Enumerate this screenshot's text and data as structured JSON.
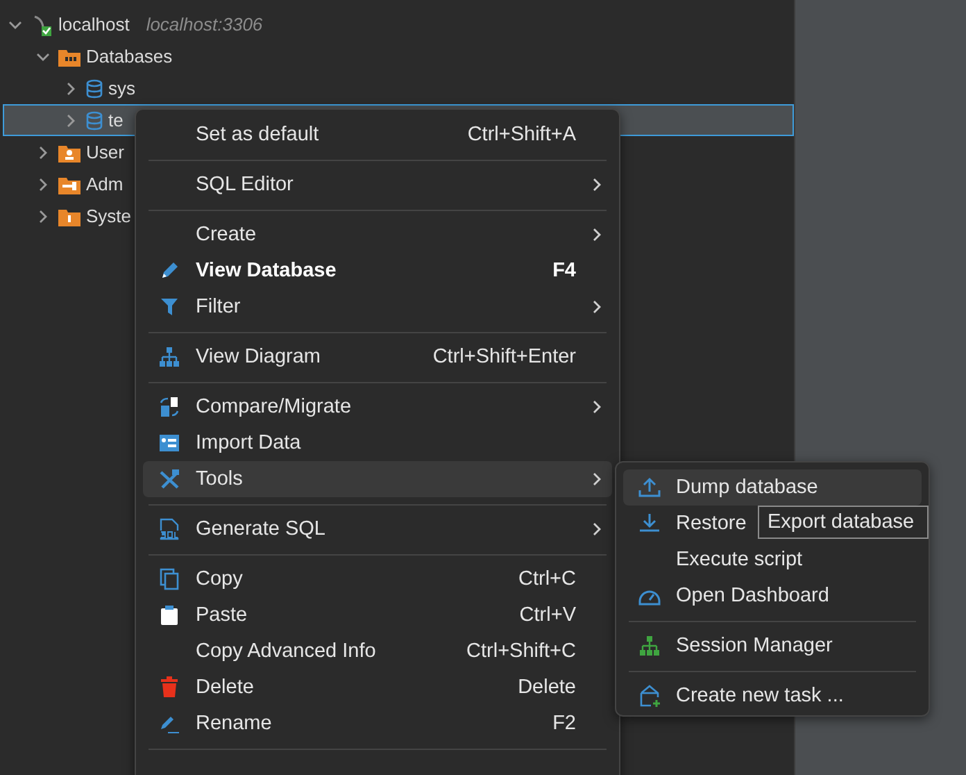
{
  "tree": [
    {
      "kind": "connection",
      "label": "localhost",
      "detail": "localhost:3306",
      "expanded": true,
      "selected": false,
      "children": [
        {
          "kind": "folder",
          "label": "Databases",
          "expanded": true,
          "selected": false,
          "children": [
            {
              "kind": "database",
              "label": "sys",
              "expanded": false,
              "selected": false
            },
            {
              "kind": "database",
              "label": "te",
              "expanded": false,
              "selected": true
            }
          ]
        },
        {
          "kind": "folder",
          "label": "User",
          "expanded": false,
          "selected": false
        },
        {
          "kind": "folder",
          "label": "Adm",
          "expanded": false,
          "selected": false
        },
        {
          "kind": "folder",
          "label": "Syste",
          "expanded": false,
          "selected": false
        }
      ]
    }
  ],
  "context_menu": [
    {
      "kind": "item",
      "label": "Set as default",
      "shortcut": "Ctrl+Shift+A",
      "submenu": false,
      "bold": false,
      "selected": false
    },
    {
      "kind": "separator"
    },
    {
      "kind": "item",
      "label": "SQL Editor",
      "submenu": true,
      "bold": false,
      "selected": false
    },
    {
      "kind": "separator"
    },
    {
      "kind": "item",
      "label": "Create",
      "submenu": true,
      "bold": false,
      "selected": false
    },
    {
      "kind": "item",
      "label": "View Database",
      "shortcut": "F4",
      "submenu": false,
      "bold": true,
      "selected": false
    },
    {
      "kind": "item",
      "label": "Filter",
      "submenu": true,
      "bold": false,
      "selected": false
    },
    {
      "kind": "separator"
    },
    {
      "kind": "item",
      "label": "View Diagram",
      "shortcut": "Ctrl+Shift+Enter",
      "submenu": false,
      "bold": false,
      "selected": false
    },
    {
      "kind": "separator"
    },
    {
      "kind": "item",
      "label": "Compare/Migrate",
      "submenu": true,
      "bold": false,
      "selected": false
    },
    {
      "kind": "item",
      "label": "Import Data",
      "submenu": false,
      "bold": false,
      "selected": false
    },
    {
      "kind": "item",
      "label": "Tools",
      "submenu": true,
      "bold": false,
      "selected": true
    },
    {
      "kind": "separator"
    },
    {
      "kind": "item",
      "label": "Generate SQL",
      "submenu": true,
      "bold": false,
      "selected": false
    },
    {
      "kind": "separator"
    },
    {
      "kind": "item",
      "label": "Copy",
      "shortcut": "Ctrl+C",
      "submenu": false,
      "bold": false,
      "selected": false
    },
    {
      "kind": "item",
      "label": "Paste",
      "shortcut": "Ctrl+V",
      "submenu": false,
      "bold": false,
      "selected": false
    },
    {
      "kind": "item",
      "label": "Copy Advanced Info",
      "shortcut": "Ctrl+Shift+C",
      "submenu": false,
      "bold": false,
      "selected": false
    },
    {
      "kind": "item",
      "label": "Delete",
      "shortcut": "Delete",
      "submenu": false,
      "bold": false,
      "selected": false
    },
    {
      "kind": "item",
      "label": "Rename",
      "shortcut": "F2",
      "submenu": false,
      "bold": false,
      "selected": false
    },
    {
      "kind": "separator"
    }
  ],
  "tools_submenu": [
    {
      "kind": "item",
      "label": "Dump database",
      "selected": true
    },
    {
      "kind": "item",
      "label": "Restore",
      "selected": false
    },
    {
      "kind": "item",
      "label": "Execute script",
      "selected": false
    },
    {
      "kind": "item",
      "label": "Open Dashboard",
      "selected": false
    },
    {
      "kind": "separator"
    },
    {
      "kind": "item",
      "label": "Session Manager",
      "selected": false
    },
    {
      "kind": "separator"
    },
    {
      "kind": "item",
      "label": "Create new task ..."
    }
  ],
  "tooltip": "Export database"
}
